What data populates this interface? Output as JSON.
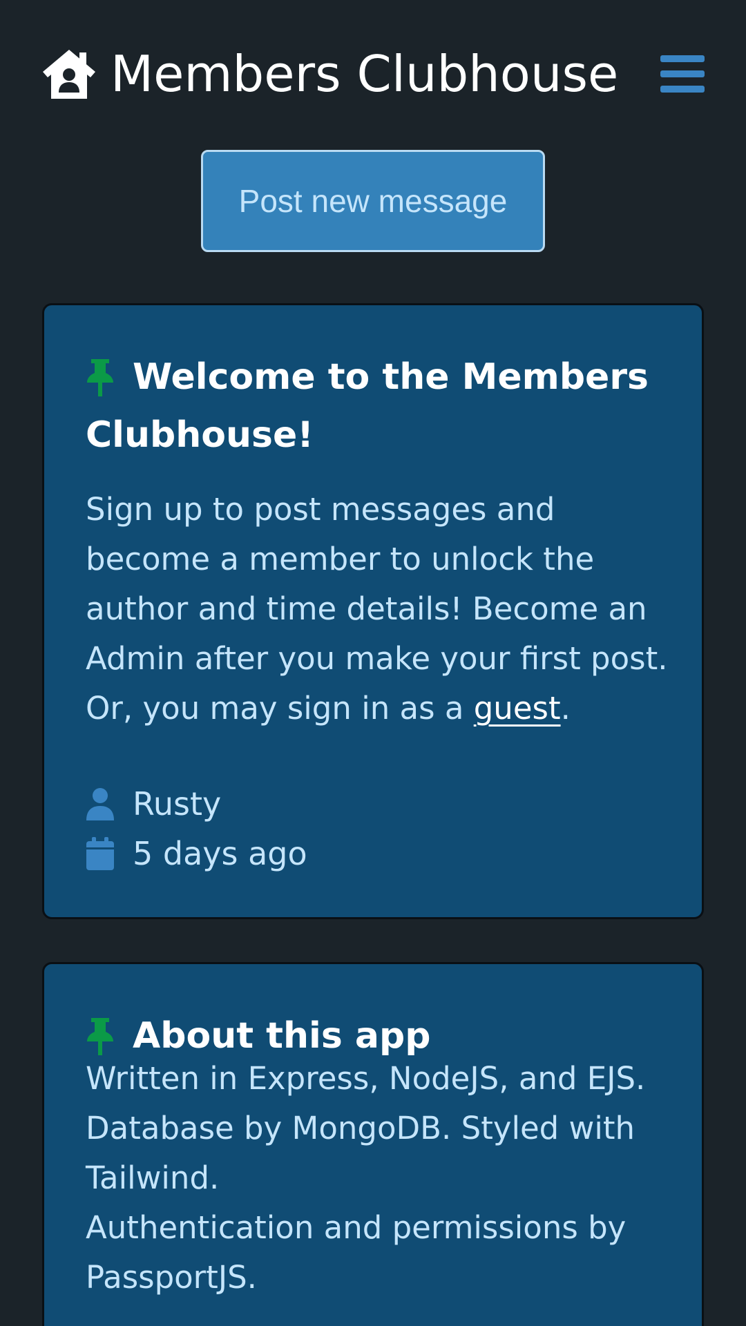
{
  "header": {
    "title": "Members Clubhouse",
    "logo_icon": "house-user-icon",
    "menu_icon": "hamburger-menu-icon"
  },
  "actions": {
    "post_new_message_label": "Post new message"
  },
  "messages": [
    {
      "pinned": true,
      "title": "Welcome to the Members Clubhouse!",
      "body_before_link": "Sign up to post messages and become a member to unlock the author and time details! Become an Admin after you make your first post. Or, you may sign in as a ",
      "link_label": "guest",
      "body_after_link": ".",
      "author": "Rusty",
      "time": "5 days ago"
    },
    {
      "pinned": true,
      "title": "About this app",
      "body_lines": [
        "Written in Express, NodeJS, and EJS. Database by MongoDB. Styled with Tailwind.",
        "Authentication and permissions by PassportJS."
      ]
    }
  ],
  "colors": {
    "page_background": "#1b2329",
    "card_background": "#104c74",
    "button_background": "#3482ba",
    "accent_blue": "#3a85c4",
    "pin_green": "#0b9a47",
    "body_text": "#c5e5fb",
    "heading_text": "#ffffff"
  }
}
